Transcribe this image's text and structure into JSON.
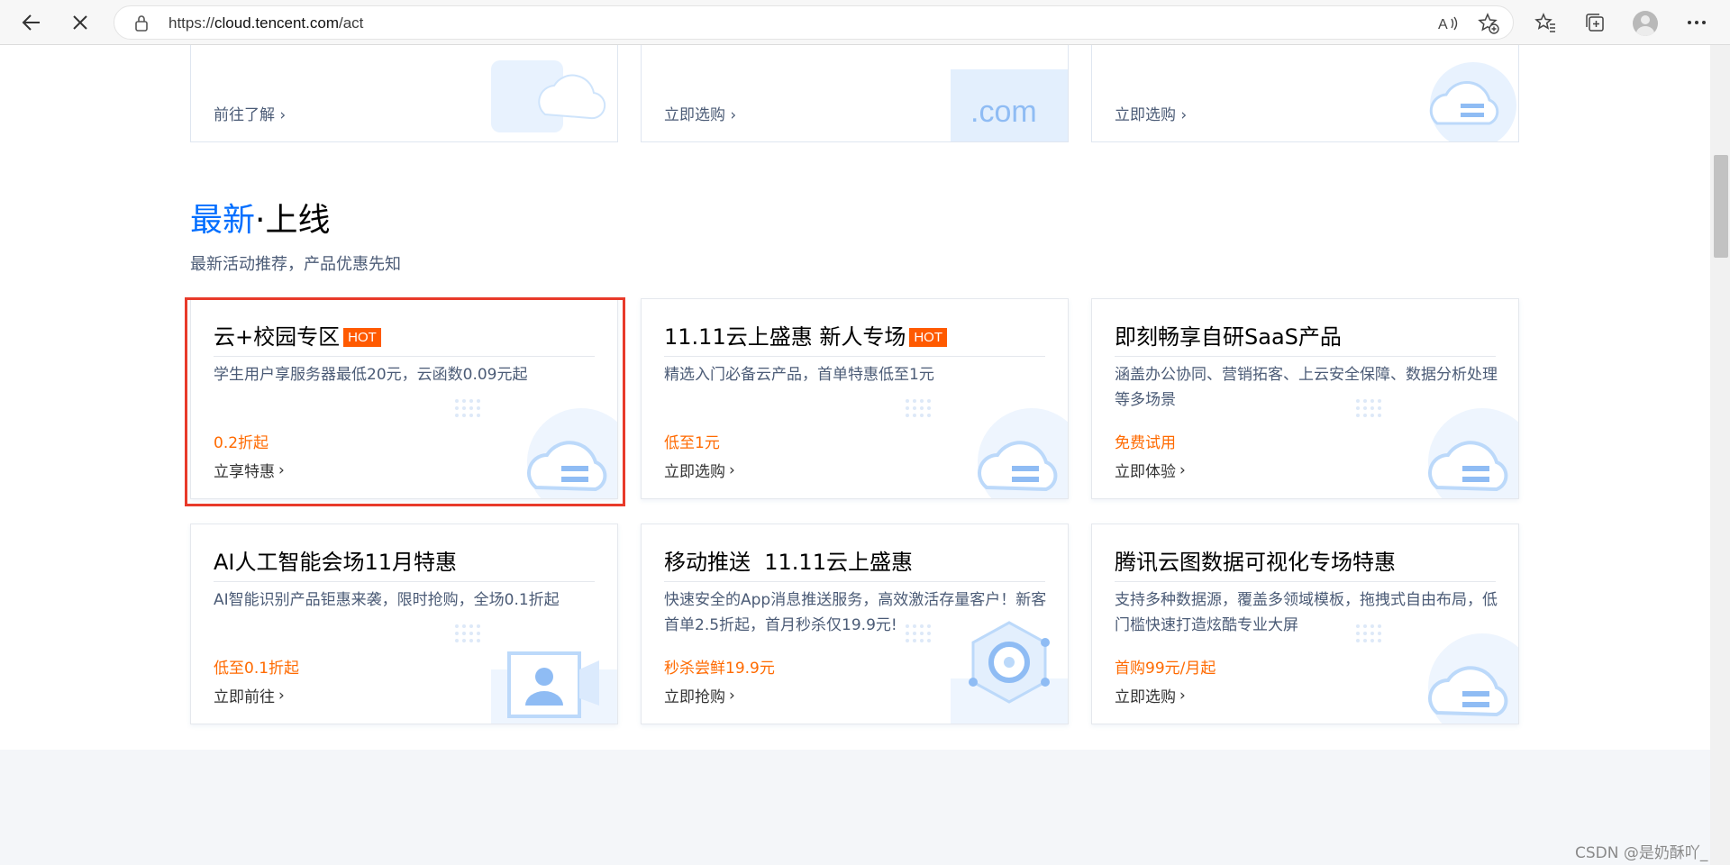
{
  "browser": {
    "url_prefix": "https://",
    "url_domain": "cloud.tencent.com",
    "url_path": "/act"
  },
  "top_row": [
    {
      "cta": "前往了解"
    },
    {
      "cta": "立即选购"
    },
    {
      "cta": "立即选购"
    }
  ],
  "section": {
    "title_accent": "最新",
    "title_rest": "·上线",
    "subtitle": "最新活动推荐，产品优惠先知"
  },
  "cards": [
    {
      "title": "云+校园专区",
      "hot": "HOT",
      "desc": "学生用户享服务器最低20元，云函数0.09元起",
      "price": "0.2折起",
      "cta": "立享特惠"
    },
    {
      "title": "11.11云上盛惠 新人专场",
      "hot": "HOT",
      "desc": "精选入门必备云产品，首单特惠低至1元",
      "price": "低至1元",
      "cta": "立即选购"
    },
    {
      "title": "即刻畅享自研SaaS产品",
      "hot": "",
      "desc": "涵盖办公协同、营销拓客、上云安全保障、数据分析处理等多场景",
      "price": "免费试用",
      "cta": "立即体验"
    },
    {
      "title": "AI人工智能会场11月特惠",
      "hot": "",
      "desc": "AI智能识别产品钜惠来袭，限时抢购，全场0.1折起",
      "price": "低至0.1折起",
      "cta": "立即前往"
    },
    {
      "title": "移动推送  11.11云上盛惠",
      "hot": "",
      "desc": "快速安全的App消息推送服务，高效激活存量客户！新客首单2.5折起，首月秒杀仅19.9元!",
      "price": "秒杀尝鲜19.9元",
      "cta": "立即抢购"
    },
    {
      "title": "腾讯云图数据可视化专场特惠",
      "hot": "",
      "desc": "支持多种数据源，覆盖多领域模板，拖拽式自由布局，低门槛快速打造炫酷专业大屏",
      "price": "首购99元/月起",
      "cta": "立即选购"
    }
  ],
  "watermark": "CSDN @是奶酥吖_",
  "colors": {
    "accent": "#006eff",
    "price": "#ff6a00",
    "hot": "#ff5a00",
    "highlight": "#e83a2a"
  }
}
